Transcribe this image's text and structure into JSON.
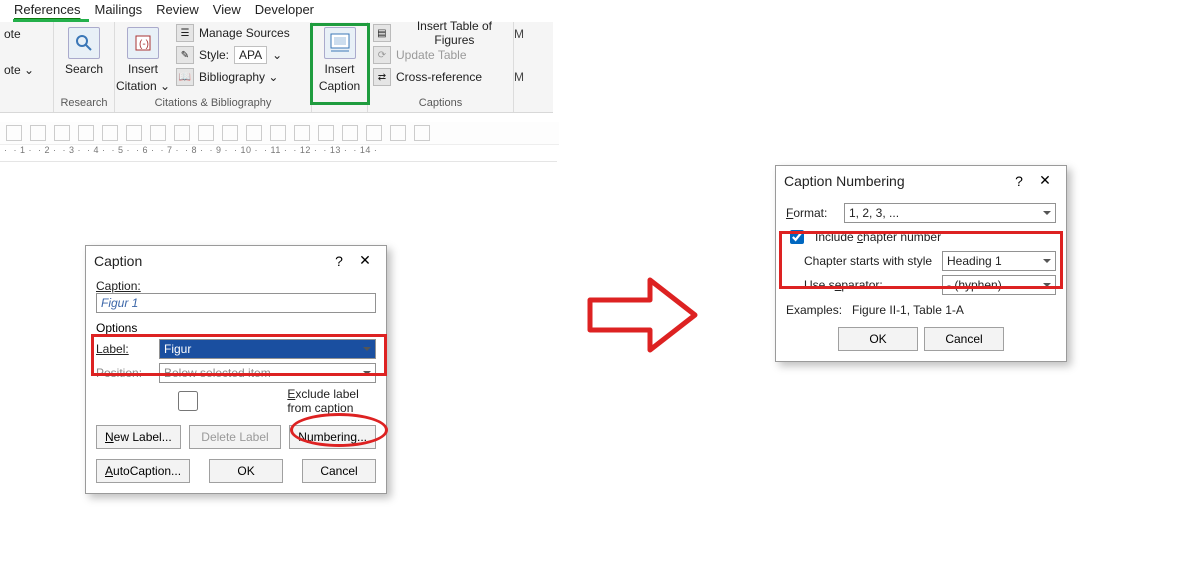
{
  "tabs": {
    "references": "References",
    "mailings": "Mailings",
    "review": "Review",
    "view": "View",
    "developer": "Developer"
  },
  "ribbon": {
    "note_top": "ote",
    "note_bottom": "ote ⌄",
    "search": "Search",
    "research_group": "Research",
    "insert_citation": "Insert",
    "insert_citation2": "Citation ⌄",
    "manage_sources": "Manage Sources",
    "style_label": "Style:",
    "style_value": "APA",
    "bibliography": "Bibliography ⌄",
    "cites_group": "Citations & Bibliography",
    "insert_caption": "Insert",
    "insert_caption2": "Caption",
    "insert_tof": "Insert Table of Figures",
    "update_table": "Update Table",
    "cross_ref": "Cross-reference",
    "captions_group": "Captions",
    "m_placeholder": "M"
  },
  "ruler_text": "·  · 1 ·  · 2 ·  · 3 ·  · 4 ·  · 5 ·  · 6 ·  · 7 ·  · 8 ·  · 9 ·  · 10 ·  · 11 ·  · 12 ·  · 13 ·  · 14 ·",
  "caption_dialog": {
    "title": "Caption",
    "help": "?",
    "close": "✕",
    "caption_label": "Caption:",
    "caption_value": "Figur 1",
    "options_label": "Options",
    "label_label": "Label:",
    "label_value": "Figur",
    "position_label": "Position:",
    "position_value": "Below selected item",
    "exclude_label": "Exclude label from caption",
    "new_label_btn": "New Label...",
    "delete_label_btn": "Delete Label",
    "numbering_btn": "Numbering...",
    "autocaption_btn": "AutoCaption...",
    "ok_btn": "OK",
    "cancel_btn": "Cancel"
  },
  "num_dialog": {
    "title": "Caption Numbering",
    "help": "?",
    "close": "✕",
    "format_label": "Format:",
    "format_value": "1, 2, 3, ...",
    "include_label": "Include chapter number",
    "chapter_style_label": "Chapter starts with style",
    "chapter_style_value": "Heading 1",
    "separator_label": "Use separator:",
    "separator_value": "-   (hyphen)",
    "examples_label": "Examples:",
    "examples_value": "Figure II-1, Table 1-A",
    "ok_btn": "OK",
    "cancel_btn": "Cancel"
  }
}
